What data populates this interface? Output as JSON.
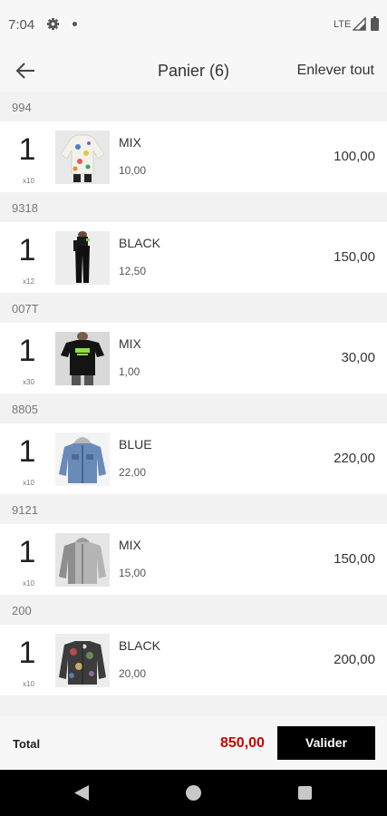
{
  "status_bar": {
    "time": "7:04",
    "network": "LTE",
    "icons": [
      "gear-icon",
      "notification-dot-icon",
      "signal-icon",
      "battery-icon"
    ]
  },
  "header": {
    "title": "Panier (6)",
    "clear_all_label": "Enlever tout",
    "back_icon": "arrow-left-icon"
  },
  "cart": {
    "items": [
      {
        "ref": "994",
        "qty": "1",
        "pack": "x10",
        "color": "MIX",
        "unit_price": "10,00",
        "line_total": "100,00",
        "product": "printed-sweatshirt"
      },
      {
        "ref": "9318",
        "qty": "1",
        "pack": "x12",
        "color": "BLACK",
        "unit_price": "12,50",
        "line_total": "150,00",
        "product": "black-pants"
      },
      {
        "ref": "007T",
        "qty": "1",
        "pack": "x30",
        "color": "MIX",
        "unit_price": "1,00",
        "line_total": "30,00",
        "product": "graphic-tshirt"
      },
      {
        "ref": "8805",
        "qty": "1",
        "pack": "x10",
        "color": "BLUE",
        "unit_price": "22,00",
        "line_total": "220,00",
        "product": "denim-jacket"
      },
      {
        "ref": "9121",
        "qty": "1",
        "pack": "x10",
        "color": "MIX",
        "unit_price": "15,00",
        "line_total": "150,00",
        "product": "grey-jacket"
      },
      {
        "ref": "200",
        "qty": "1",
        "pack": "x10",
        "color": "BLACK",
        "unit_price": "20,00",
        "line_total": "200,00",
        "product": "camo-jacket"
      }
    ]
  },
  "footer": {
    "total_label": "Total",
    "total_value": "850,00",
    "validate_label": "Valider"
  },
  "colors": {
    "accent_total": "#cc0000",
    "button_bg": "#000000",
    "background": "#f2f2f2"
  }
}
